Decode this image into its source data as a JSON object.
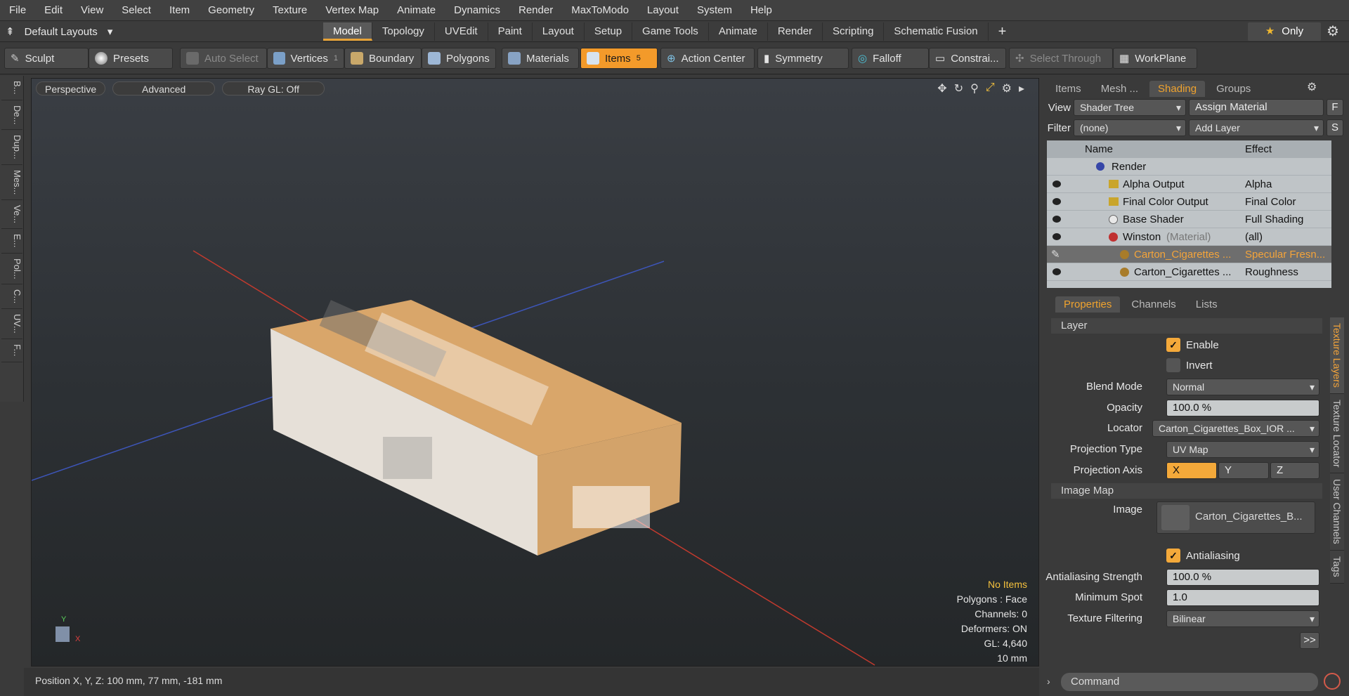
{
  "menu": [
    "File",
    "Edit",
    "View",
    "Select",
    "Item",
    "Geometry",
    "Texture",
    "Vertex Map",
    "Animate",
    "Dynamics",
    "Render",
    "MaxToModo",
    "Layout",
    "System",
    "Help"
  ],
  "layout": {
    "name": "Default Layouts",
    "tabs": [
      "Model",
      "Topology",
      "UVEdit",
      "Paint",
      "Layout",
      "Setup",
      "Game Tools",
      "Animate",
      "Render",
      "Scripting",
      "Schematic Fusion"
    ],
    "active_tab": "Model",
    "only": "Only"
  },
  "toolbar": {
    "sculpt": "Sculpt",
    "presets": "Presets",
    "auto_select": "Auto Select",
    "vertices": "Vertices",
    "vertices_count": "1",
    "boundary": "Boundary",
    "polygons": "Polygons",
    "materials": "Materials",
    "items": "Items",
    "items_count": "5",
    "action_center": "Action Center",
    "symmetry": "Symmetry",
    "falloff": "Falloff",
    "constraints": "Constrai...",
    "select_through": "Select Through",
    "workplane": "WorkPlane"
  },
  "left_tabs": [
    "B...",
    "De...",
    "Dup...",
    "Mes...",
    "Ve...",
    "E...",
    "Pol...",
    "C...",
    "UV...",
    "F..."
  ],
  "viewport": {
    "perspective": "Perspective",
    "advanced": "Advanced",
    "raygl": "Ray GL: Off",
    "stats": {
      "items": "No Items",
      "polygons": "Polygons : Face",
      "channels": "Channels: 0",
      "deformers": "Deformers: ON",
      "gl": "GL: 4,640",
      "scale": "10 mm"
    }
  },
  "status": {
    "position": "Position X, Y, Z:   100 mm, 77 mm, -181 mm"
  },
  "shading": {
    "tabs": [
      "Items",
      "Mesh ...",
      "Shading",
      "Groups"
    ],
    "active": "Shading",
    "view_label": "View",
    "view_value": "Shader Tree",
    "assign": "Assign Material",
    "assign_key": "F",
    "filter_label": "Filter",
    "filter_value": "(none)",
    "add_layer": "Add Layer",
    "add_key": "S",
    "col_name": "Name",
    "col_effect": "Effect",
    "rows": [
      {
        "name": "Render",
        "effect": ""
      },
      {
        "name": "Alpha Output",
        "effect": "Alpha"
      },
      {
        "name": "Final Color Output",
        "effect": "Final Color"
      },
      {
        "name": "Base Shader",
        "effect": "Full Shading"
      },
      {
        "name": "Winston",
        "suffix": "(Material)",
        "effect": "(all)"
      },
      {
        "name": "Carton_Cigarettes ...",
        "effect": "Specular Fresn..."
      },
      {
        "name": "Carton_Cigarettes ...",
        "effect": "Roughness"
      }
    ]
  },
  "properties": {
    "tabs": [
      "Properties",
      "Channels",
      "Lists"
    ],
    "active": "Properties",
    "section_layer": "Layer",
    "enable": "Enable",
    "invert": "Invert",
    "blend_label": "Blend Mode",
    "blend": "Normal",
    "opacity_label": "Opacity",
    "opacity": "100.0 %",
    "locator_label": "Locator",
    "locator": "Carton_Cigarettes_Box_IOR ...",
    "proj_type_label": "Projection Type",
    "proj_type": "UV Map",
    "proj_axis_label": "Projection Axis",
    "axis_x": "X",
    "axis_y": "Y",
    "axis_z": "Z",
    "section_image": "Image Map",
    "image_label": "Image",
    "image": "Carton_Cigarettes_B...",
    "antialiasing": "Antialiasing",
    "aa_strength_label": "Antialiasing Strength",
    "aa_strength": "100.0 %",
    "min_spot_label": "Minimum Spot",
    "min_spot": "1.0",
    "tex_filter_label": "Texture Filtering",
    "tex_filter": "Bilinear",
    "more": ">>",
    "vtabs": [
      "Texture Layers",
      "Texture Locator",
      "User Channels",
      "Tags"
    ]
  },
  "command": {
    "placeholder": "Command"
  },
  "colors": {
    "accent": "#f39a2a",
    "panel": "#3c3c3c"
  }
}
